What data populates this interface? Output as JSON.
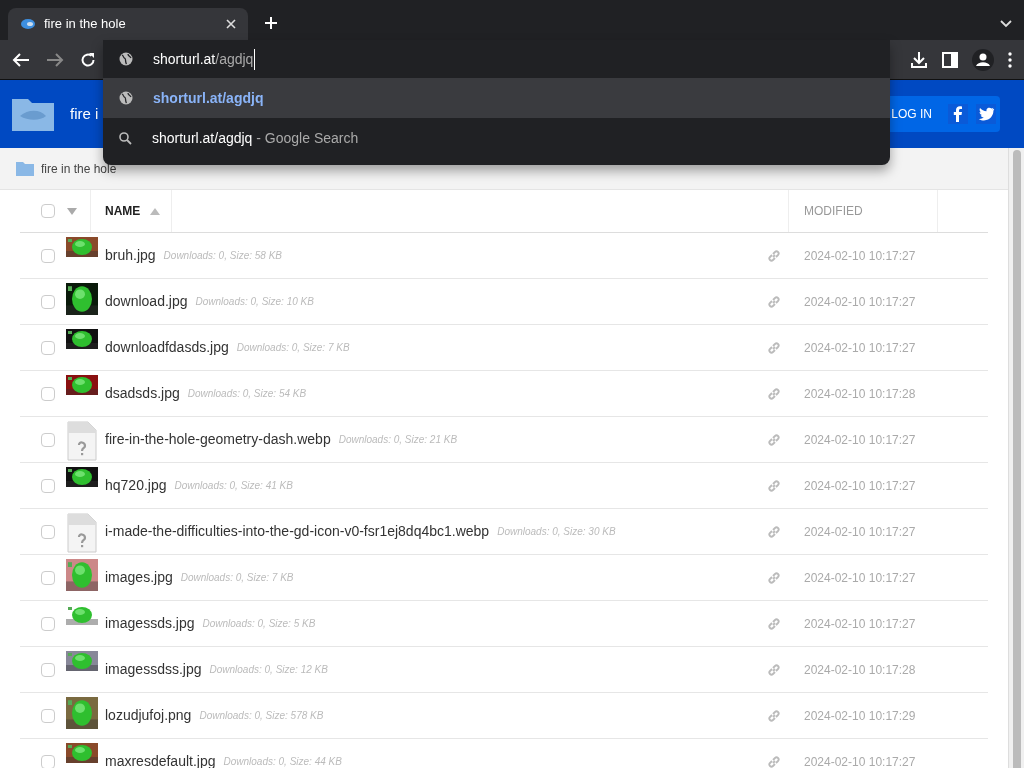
{
  "browser": {
    "tab": {
      "title": "fire in the hole",
      "selected": true
    },
    "address_bar": {
      "host": "shorturl.at",
      "path": "/agdjq"
    },
    "suggestions": [
      {
        "kind": "url",
        "text": "shorturl.at/agdjq",
        "selected": true
      },
      {
        "kind": "search",
        "text": "shorturl.at/agdjq",
        "suffix": "- Google Search",
        "selected": false
      }
    ]
  },
  "header": {
    "title": "fire i",
    "login": "LOG IN"
  },
  "breadcrumb": "fire in the hole",
  "table": {
    "all_checked": false,
    "columns": [
      "NAME",
      "MODIFIED"
    ],
    "rows": [
      {
        "kind": "picture",
        "name": "bruh.jpg",
        "info": "Downloads: 0, Size: 58 KB",
        "modified": "2024-02-10 10:17:27",
        "checked": false
      },
      {
        "kind": "picture",
        "name": "download.jpg",
        "info": "Downloads: 0, Size: 10 KB",
        "modified": "2024-02-10 10:17:27",
        "checked": false
      },
      {
        "kind": "picture",
        "name": "downloadfdasds.jpg",
        "info": "Downloads: 0, Size: 7 KB",
        "modified": "2024-02-10 10:17:27",
        "checked": false
      },
      {
        "kind": "picture",
        "name": "dsadsds.jpg",
        "info": "Downloads: 0, Size: 54 KB",
        "modified": "2024-02-10 10:17:28",
        "checked": false
      },
      {
        "kind": "unknown",
        "name": "fire-in-the-hole-geometry-dash.webp",
        "info": "Downloads: 0, Size: 21 KB",
        "modified": "2024-02-10 10:17:27",
        "checked": false
      },
      {
        "kind": "picture",
        "name": "hq720.jpg",
        "info": "Downloads: 0, Size: 41 KB",
        "modified": "2024-02-10 10:17:27",
        "checked": false
      },
      {
        "kind": "unknown",
        "name": "i-made-the-difficulties-into-the-gd-icon-v0-fsr1ej8dq4bc1.webp",
        "info": "Downloads: 0, Size: 30 KB",
        "modified": "2024-02-10 10:17:27",
        "checked": false
      },
      {
        "kind": "picture",
        "name": "images.jpg",
        "info": "Downloads: 0, Size: 7 KB",
        "modified": "2024-02-10 10:17:27",
        "checked": false
      },
      {
        "kind": "picture",
        "name": "imagessds.jpg",
        "info": "Downloads: 0, Size: 5 KB",
        "modified": "2024-02-10 10:17:27",
        "checked": false
      },
      {
        "kind": "picture",
        "name": "imagessdss.jpg",
        "info": "Downloads: 0, Size: 12 KB",
        "modified": "2024-02-10 10:17:28",
        "checked": false
      },
      {
        "kind": "picture",
        "name": "lozudjufoj.png",
        "info": "Downloads: 0, Size: 578 KB",
        "modified": "2024-02-10 10:17:29",
        "checked": false
      },
      {
        "kind": "picture",
        "name": "maxresdefault.jpg",
        "info": "Downloads: 0, Size: 44 KB",
        "modified": "2024-02-10 10:17:27",
        "checked": false
      }
    ]
  }
}
